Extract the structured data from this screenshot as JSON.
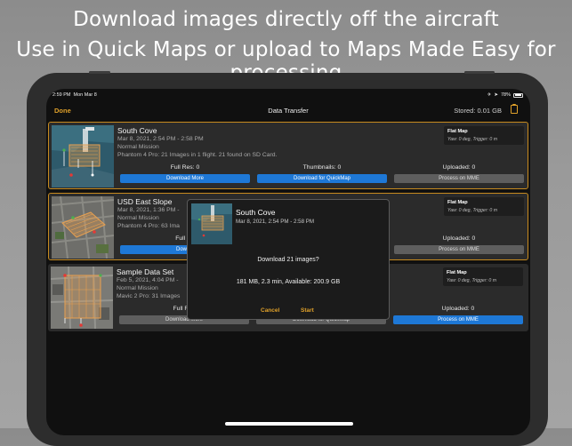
{
  "hero": {
    "line1": "Download images directly off the aircraft",
    "line2": "Use in Quick Maps or upload to Maps Made Easy for processing"
  },
  "status_bar": {
    "time": "2:59 PM",
    "date": "Mon Mar 8",
    "battery": "78%",
    "battery_level": 0.78
  },
  "nav": {
    "done": "Done",
    "title": "Data Transfer",
    "stored": "Stored: 0.01 GB",
    "clipboard_icon": "clipboard-icon"
  },
  "missions": [
    {
      "name": "South Cove",
      "date": "Mar 8, 2021, 2:54 PM - 2:58 PM",
      "mission_type": "Normal Mission",
      "details": "Phantom 4 Pro: 21 Images in 1 flight. 21 found on SD Card.",
      "map_type": "Flat Map",
      "settings": "Yaw: 0 deg, Trigger: 0 m",
      "full_res": "Full Res: 0",
      "thumbnails": "Thumbnails: 0",
      "uploaded": "Uploaded: 0",
      "btn_download_more": "Download More",
      "btn_quickmap": "Download for QuickMap",
      "btn_process": "Process on MME",
      "selected": true
    },
    {
      "name": "USD East Slope",
      "date": "Mar 8, 2021, 1:36 PM -",
      "mission_type": "Normal Mission",
      "details": "Phantom 4 Pro: 63 Ima",
      "map_type": "Flat Map",
      "settings": "Yaw: 0 deg, Trigger: 0 m",
      "full_res": "Full Re",
      "btn_download_partial": "Downlo",
      "uploaded": "Uploaded: 0",
      "btn_process": "Process on MME",
      "selected": true
    },
    {
      "name": "Sample Data Set",
      "date": "Feb 5, 2021, 4:04 PM -",
      "mission_type": "Normal Mission",
      "details": "Mavic 2 Pro: 31 Images",
      "map_type": "Flat Map",
      "settings": "Yaw: 0 deg, Trigger: 0 m",
      "full_res": "Full Res",
      "btn_download_more": "Download More",
      "btn_quickmap": "Download for QuickMap",
      "uploaded": "Uploaded: 0",
      "btn_process": "Process on MME",
      "selected": false
    }
  ],
  "dialog": {
    "name": "South Cove",
    "date": "Mar 8, 2021, 2:54 PM - 2:58 PM",
    "question": "Download 21 images?",
    "info": "181 MB, 2.3 min, Available: 200.9 GB",
    "cancel": "Cancel",
    "start": "Start"
  },
  "colors": {
    "accent": "#e0a12a",
    "blue": "#1e78d6",
    "gray_button": "#5e5e5e",
    "card": "#2b2b2b"
  }
}
